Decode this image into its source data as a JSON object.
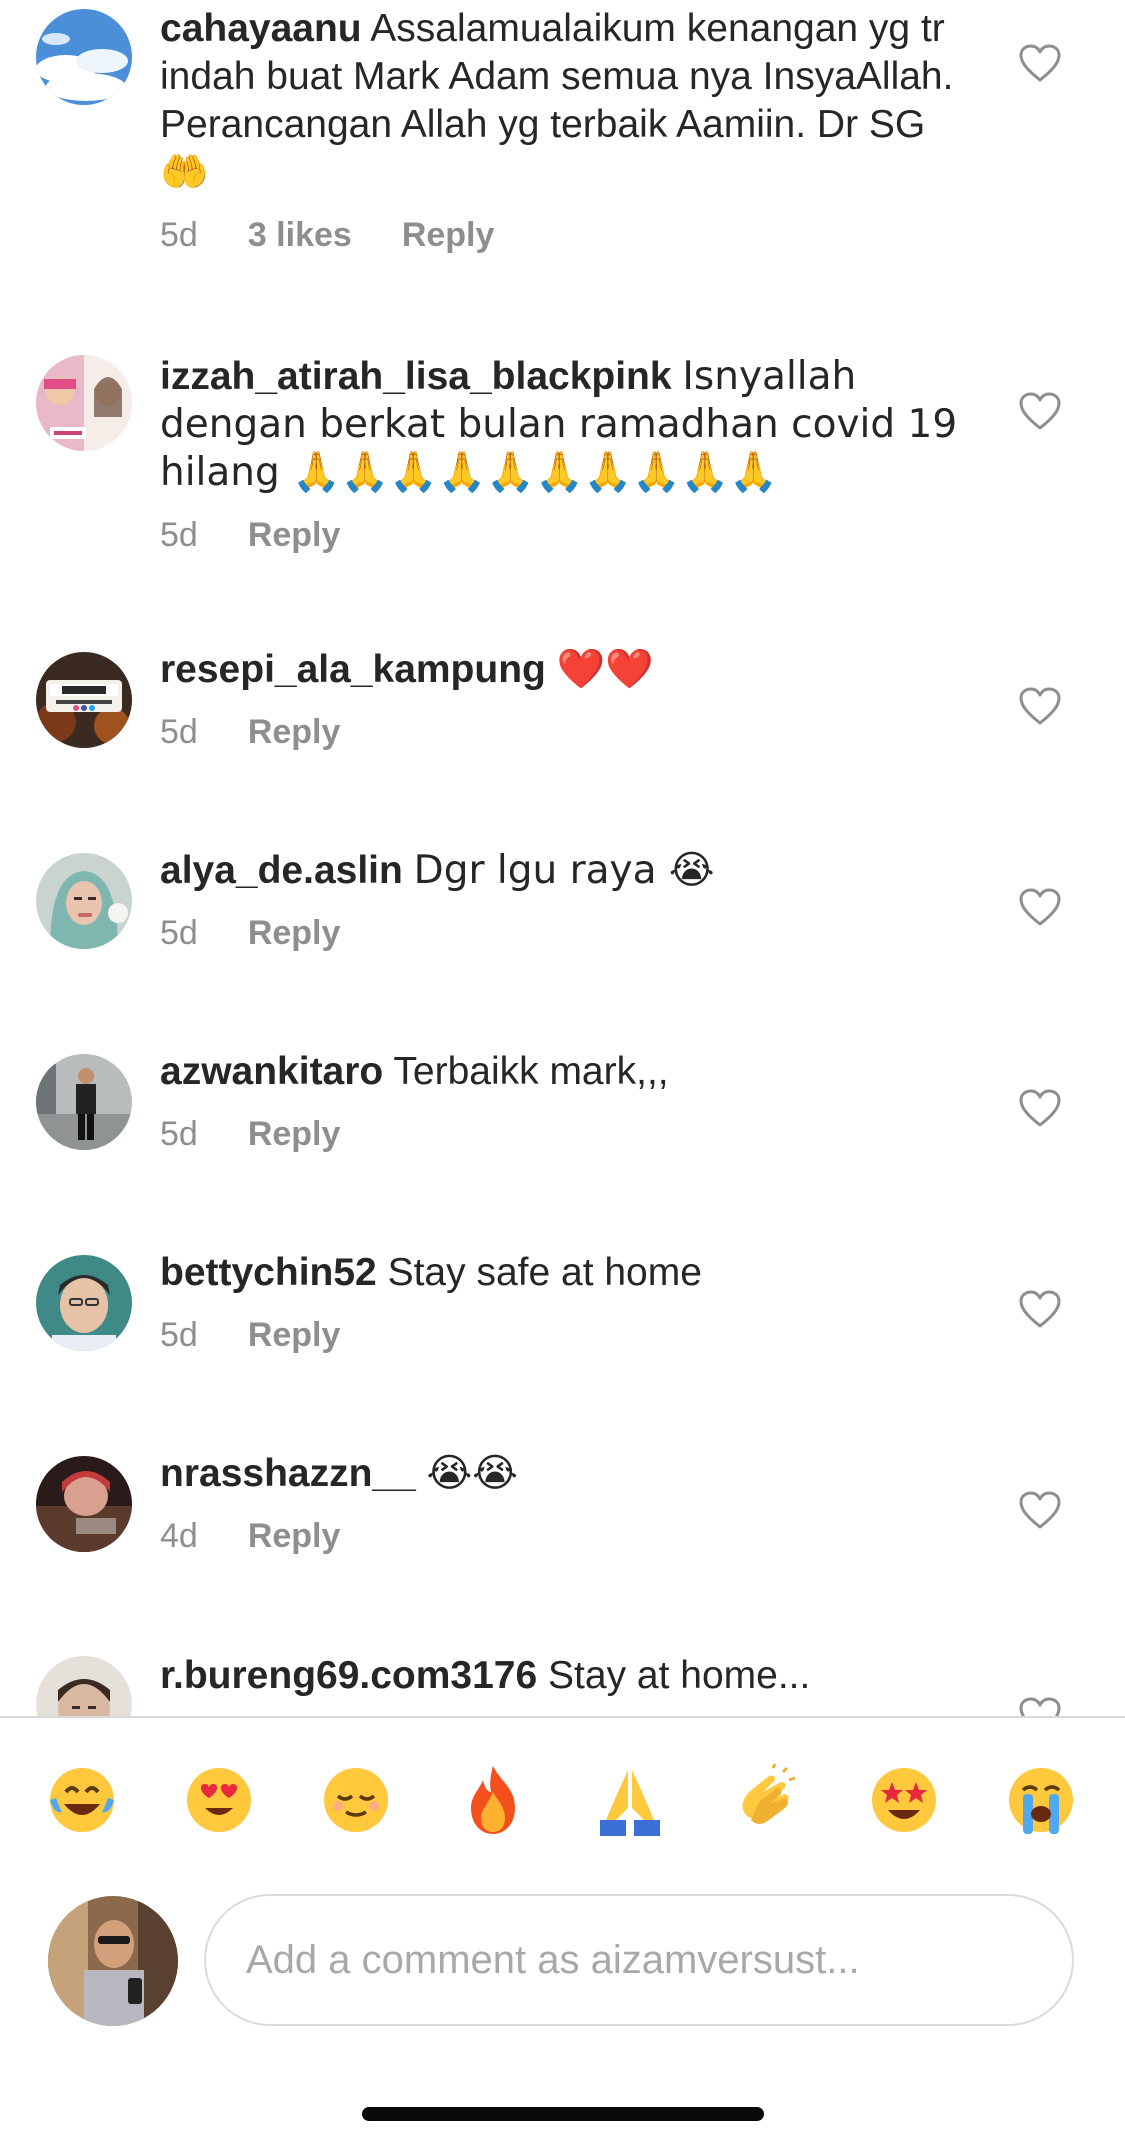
{
  "comments": [
    {
      "username": "cahayaanu",
      "text": "Assalamualaikum kenangan yg tr indah buat Mark Adam semua nya InsyaAllah. Perancangan Allah yg terbaik Aamiin. Dr SG🤲",
      "time": "5d",
      "likes": "3 likes",
      "reply": "Reply"
    },
    {
      "username": "izzah_atirah_lisa_blackpink",
      "text": "Isnyallah dengan berkat bulan ramadhan covid 19 hilang 🙏🙏🙏🙏🙏🙏🙏🙏🙏🙏",
      "time": "5d",
      "reply": "Reply"
    },
    {
      "username": "resepi_ala_kampung",
      "text": "❤️❤️",
      "time": "5d",
      "reply": "Reply"
    },
    {
      "username": "alya_de.aslin",
      "text": "Dgr lgu raya 😭",
      "time": "5d",
      "reply": "Reply"
    },
    {
      "username": "azwankitaro",
      "text": "Terbaikk mark,,,",
      "time": "5d",
      "reply": "Reply"
    },
    {
      "username": "bettychin52",
      "text": "Stay safe at home",
      "time": "5d",
      "reply": "Reply"
    },
    {
      "username": "nrasshazzn__",
      "text": "😭😭",
      "time": "4d",
      "reply": "Reply"
    },
    {
      "username": "r.bureng69.com3176",
      "text": "Stay at home...",
      "time": "",
      "reply": ""
    }
  ],
  "emoji_bar": [
    {
      "name": "tears-of-joy-emoji",
      "glyph": "😂"
    },
    {
      "name": "heart-eyes-emoji",
      "glyph": "😍"
    },
    {
      "name": "relieved-emoji",
      "glyph": "😌"
    },
    {
      "name": "fire-emoji",
      "glyph": "🔥"
    },
    {
      "name": "folded-hands-emoji",
      "glyph": "🙏"
    },
    {
      "name": "clapping-hands-emoji",
      "glyph": "👏"
    },
    {
      "name": "star-struck-emoji",
      "glyph": "🤩"
    },
    {
      "name": "loudly-crying-emoji",
      "glyph": "😭"
    }
  ],
  "composer": {
    "placeholder": "Add a comment as aizamversust..."
  },
  "icons": {
    "like": "heart-outline-icon"
  }
}
